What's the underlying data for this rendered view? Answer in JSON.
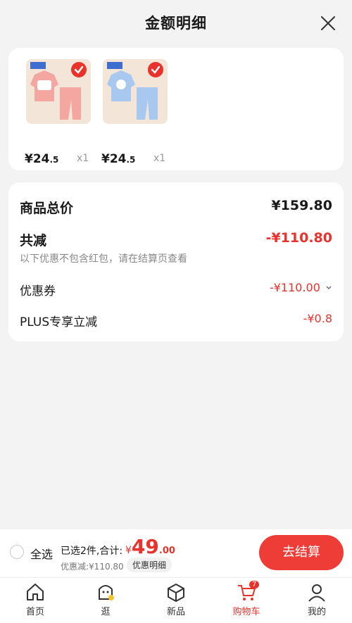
{
  "header": {
    "title": "金额明细"
  },
  "products": [
    {
      "price_int": "¥24",
      "price_dec": ".5",
      "qty": "x1",
      "color": "#f4a7a0"
    },
    {
      "price_int": "¥24",
      "price_dec": ".5",
      "qty": "x1",
      "color": "#a9c8ef"
    }
  ],
  "summary": {
    "total_label": "商品总价",
    "total_value": "¥159.80",
    "reduce_label": "共减",
    "reduce_value": "-¥110.80",
    "reduce_note": "以下优惠不包含红包，请在结算页查看",
    "coupon_label": "优惠券",
    "coupon_value": "-¥110.00",
    "plus_label": "PLUS专享立减",
    "plus_value": "-¥0.8"
  },
  "bottom_bar": {
    "select_all": "全选",
    "selected_info": "已选2件,合计:",
    "total_cur": "¥",
    "total_int": "49",
    "total_dec": ".00",
    "discount": "优惠减:¥110.80",
    "detail": "优惠明细",
    "checkout": "去结算"
  },
  "tabs": [
    {
      "label": "首页",
      "icon": "home-icon"
    },
    {
      "label": "逛",
      "icon": "browse-icon"
    },
    {
      "label": "新品",
      "icon": "new-products-icon"
    },
    {
      "label": "购物车",
      "icon": "cart-icon",
      "badge": "7"
    },
    {
      "label": "我的",
      "icon": "profile-icon"
    }
  ],
  "colors": {
    "accent": "#e8322b",
    "button": "#ee3c36"
  }
}
